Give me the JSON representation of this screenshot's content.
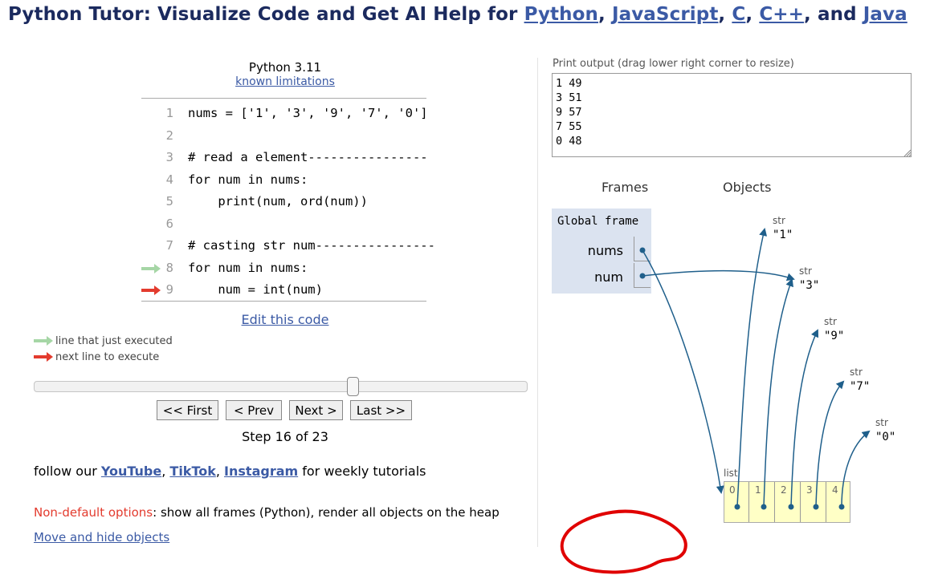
{
  "header": {
    "title_prefix": "Python Tutor: Visualize Code and Get AI Help for ",
    "langs": [
      "Python",
      "JavaScript",
      "C",
      "C++",
      "Java"
    ],
    "sep1": ", ",
    "sep_and": ", and "
  },
  "editor": {
    "language": "Python 3.11",
    "limitations_link": "known limitations",
    "lines": [
      {
        "num": "1",
        "code": "nums = ['1', '3', '9', '7', '0']"
      },
      {
        "num": "2",
        "code": ""
      },
      {
        "num": "3",
        "code": "# read a element----------------"
      },
      {
        "num": "4",
        "code": "for num in nums:"
      },
      {
        "num": "5",
        "code": "    print(num, ord(num))"
      },
      {
        "num": "6",
        "code": ""
      },
      {
        "num": "7",
        "code": "# casting str num----------------"
      },
      {
        "num": "8",
        "code": "for num in nums:"
      },
      {
        "num": "9",
        "code": "    num = int(num)"
      }
    ],
    "just_executed_line": 8,
    "next_line": 9,
    "edit_link": "Edit this code"
  },
  "legend": {
    "just_executed": "line that just executed",
    "next_to_execute": "next line to execute",
    "just_executed_color": "#a6d6a6",
    "next_color": "#e33b2e"
  },
  "navigation": {
    "first": "<< First",
    "prev": "< Prev",
    "next": "Next >",
    "last": "Last >>",
    "step_text": "Step 16 of 23",
    "slider_fraction": 0.68
  },
  "promo": {
    "prefix": "follow our ",
    "links": [
      "YouTube",
      "TikTok",
      "Instagram"
    ],
    "suffix": " for weekly tutorials"
  },
  "options": {
    "label": "Non-default options",
    "text": ": show all frames (Python), render all objects on the heap",
    "label_color": "#e33b2e"
  },
  "move_link": "Move and hide objects",
  "output": {
    "label": "Print output (drag lower right corner to resize)",
    "lines": [
      "1 49",
      "3 51",
      "9 57",
      "7 55",
      "0 48"
    ]
  },
  "viz": {
    "frames_heading": "Frames",
    "objects_heading": "Objects",
    "global_frame": "Global frame",
    "vars": [
      "nums",
      "num"
    ],
    "strings": [
      {
        "type": "str",
        "value": "\"1\""
      },
      {
        "type": "str",
        "value": "\"3\""
      },
      {
        "type": "str",
        "value": "\"9\""
      },
      {
        "type": "str",
        "value": "\"7\""
      },
      {
        "type": "str",
        "value": "\"0\""
      }
    ],
    "list_label": "list",
    "list_indices": [
      "0",
      "1",
      "2",
      "3",
      "4"
    ],
    "arrow_color": "#1f5f8b",
    "frame_bg": "#dbe3f0",
    "list_bg": "#ffffc6"
  },
  "annotation_color": "#e00000"
}
